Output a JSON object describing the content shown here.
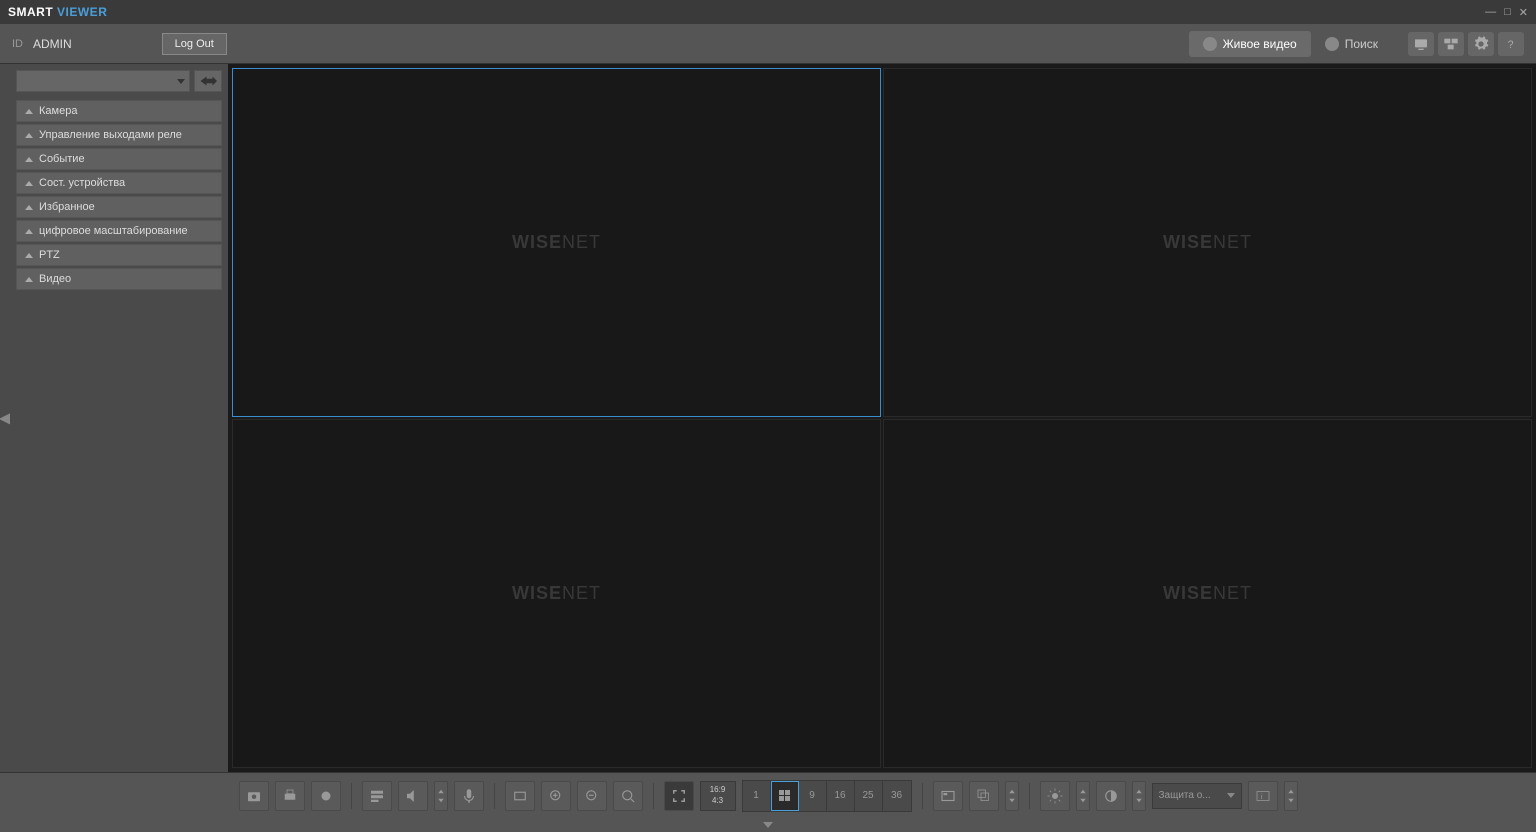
{
  "app": {
    "title_part1": "SMART",
    "title_part2": "VIEWER"
  },
  "header": {
    "id_label": "ID",
    "user": "ADMIN",
    "logout": "Log Out",
    "mode_live": "Живое видео",
    "mode_search": "Поиск"
  },
  "sidebar": {
    "items": [
      "Камера",
      "Управление выходами реле",
      "Событие",
      "Сост. устройства",
      "Избранное",
      "цифровое масштабирование",
      "PTZ",
      "Видео"
    ]
  },
  "video": {
    "watermark": "WISENET"
  },
  "toolbar": {
    "ratio1": "16:9",
    "ratio2": "4:3",
    "layouts": [
      "1",
      "4",
      "9",
      "16",
      "25",
      "36"
    ],
    "layout_active": 1,
    "protect_label": "Защита о..."
  }
}
